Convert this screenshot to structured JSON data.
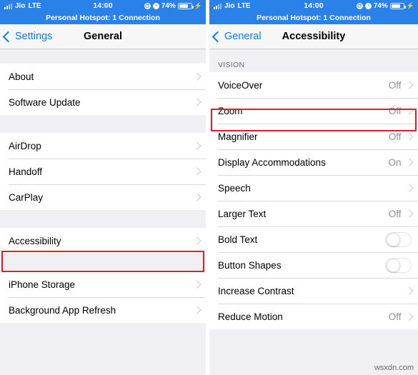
{
  "status_bar": {
    "carrier": "Jio",
    "network": "LTE",
    "time": "14:00",
    "battery_percent": "74%",
    "lock_glyph": "@",
    "alarm_glyph": "◔",
    "charging_glyph": "⚡",
    "background_color": "#2a82e8"
  },
  "hotspot_bar": {
    "text": "Personal Hotspot: 1 Connection"
  },
  "left_screen": {
    "nav": {
      "back_label": "Settings",
      "title": "General"
    },
    "groups": [
      {
        "rows": [
          {
            "label": "About",
            "value": "",
            "accessory": "chevron"
          },
          {
            "label": "Software Update",
            "value": "",
            "accessory": "chevron"
          }
        ]
      },
      {
        "rows": [
          {
            "label": "AirDrop",
            "value": "",
            "accessory": "chevron"
          },
          {
            "label": "Handoff",
            "value": "",
            "accessory": "chevron"
          },
          {
            "label": "CarPlay",
            "value": "",
            "accessory": "chevron"
          }
        ]
      },
      {
        "rows": [
          {
            "label": "Accessibility",
            "value": "",
            "accessory": "chevron",
            "highlighted": true
          }
        ]
      },
      {
        "rows": [
          {
            "label": "iPhone Storage",
            "value": "",
            "accessory": "chevron"
          },
          {
            "label": "Background App Refresh",
            "value": "",
            "accessory": "chevron"
          }
        ]
      }
    ]
  },
  "right_screen": {
    "nav": {
      "back_label": "General",
      "title": "Accessibility"
    },
    "section_header": "VISION",
    "groups": [
      {
        "rows": [
          {
            "label": "VoiceOver",
            "value": "Off",
            "accessory": "chevron"
          },
          {
            "label": "Zoom",
            "value": "Off",
            "accessory": "chevron",
            "highlighted": true
          },
          {
            "label": "Magnifier",
            "value": "Off",
            "accessory": "chevron"
          },
          {
            "label": "Display Accommodations",
            "value": "On",
            "accessory": "chevron"
          },
          {
            "label": "Speech",
            "value": "",
            "accessory": "chevron"
          },
          {
            "label": "Larger Text",
            "value": "Off",
            "accessory": "chevron"
          },
          {
            "label": "Bold Text",
            "value": "",
            "accessory": "toggle",
            "toggle_on": false
          },
          {
            "label": "Button Shapes",
            "value": "",
            "accessory": "toggle",
            "toggle_on": false
          },
          {
            "label": "Increase Contrast",
            "value": "",
            "accessory": "chevron"
          },
          {
            "label": "Reduce Motion",
            "value": "Off",
            "accessory": "chevron"
          }
        ]
      }
    ]
  },
  "watermark": "wsxdn.com",
  "colors": {
    "accent_blue": "#0a7bf0",
    "highlight_red": "#e11d2b",
    "group_bg": "#efeff4"
  }
}
